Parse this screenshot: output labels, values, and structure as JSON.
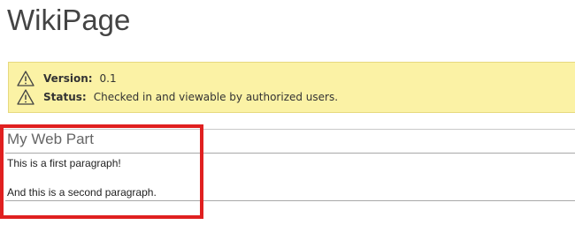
{
  "page": {
    "title": "WikiPage"
  },
  "status_bar": {
    "rows": [
      {
        "icon": "warning-icon",
        "label": "Version:",
        "value": "0.1"
      },
      {
        "icon": "warning-icon",
        "label": "Status:",
        "value": "Checked in and viewable by authorized users."
      }
    ],
    "background": "#fbf2a5"
  },
  "web_part": {
    "title": "My Web Part",
    "paragraphs": [
      "This is a first paragraph!",
      "And this is a second paragraph."
    ],
    "highlight_color": "#e02020"
  }
}
